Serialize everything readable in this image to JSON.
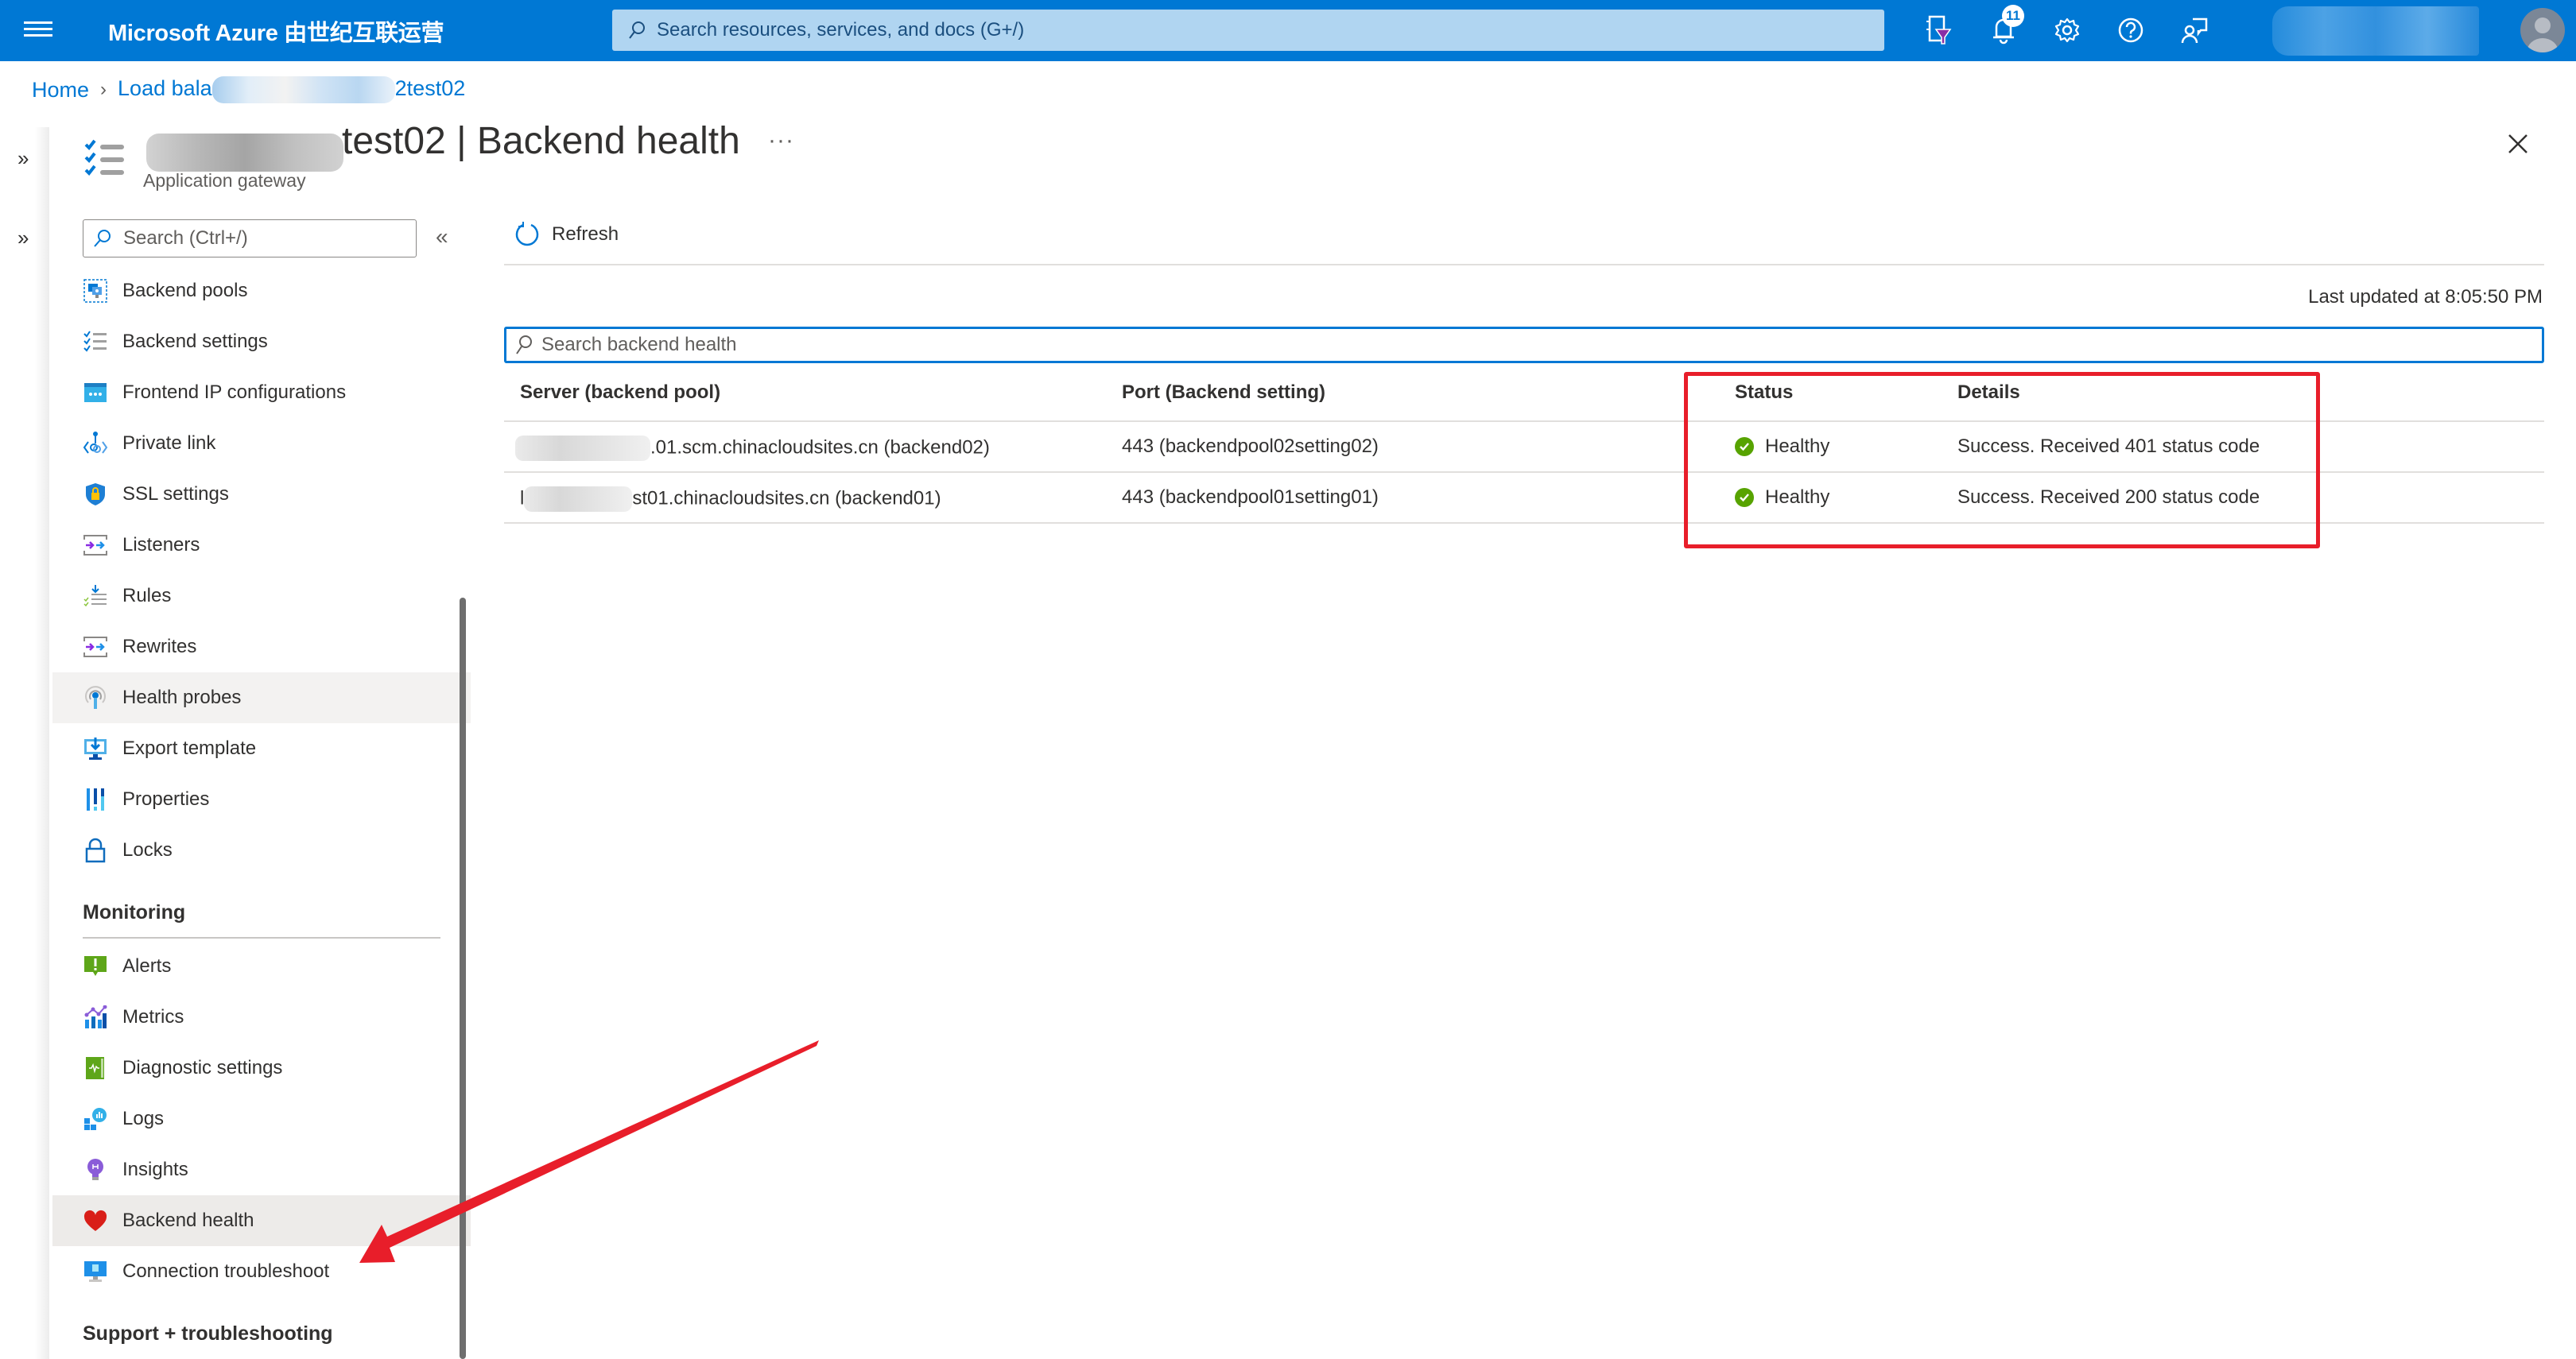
{
  "topbar": {
    "brand": "Microsoft Azure 由世纪互联运营",
    "search_placeholder": "Search resources, services, and docs (G+/)",
    "notification_count": "11",
    "icons": [
      "cloud-shell-filter-icon",
      "bell-icon",
      "gear-icon",
      "help-icon",
      "feedback-icon"
    ]
  },
  "breadcrumb": {
    "home": "Home",
    "parent_prefix": "Load bala",
    "parent_suffix": "2test02"
  },
  "blade": {
    "title_suffix": "test02 | Backend health",
    "subtitle": "Application gateway",
    "more": "···"
  },
  "sidebar": {
    "search_placeholder": "Search (Ctrl+/)",
    "items": [
      {
        "label": "Backend pools",
        "icon": "backend-pools-icon"
      },
      {
        "label": "Backend settings",
        "icon": "backend-settings-icon"
      },
      {
        "label": "Frontend IP configurations",
        "icon": "frontend-ip-icon"
      },
      {
        "label": "Private link",
        "icon": "private-link-icon"
      },
      {
        "label": "SSL settings",
        "icon": "ssl-shield-icon"
      },
      {
        "label": "Listeners",
        "icon": "listeners-icon"
      },
      {
        "label": "Rules",
        "icon": "rules-icon"
      },
      {
        "label": "Rewrites",
        "icon": "rewrites-icon"
      },
      {
        "label": "Health probes",
        "icon": "health-probes-icon"
      },
      {
        "label": "Export template",
        "icon": "export-template-icon"
      },
      {
        "label": "Properties",
        "icon": "properties-icon"
      },
      {
        "label": "Locks",
        "icon": "lock-icon"
      }
    ],
    "monitoring_heading": "Monitoring",
    "monitoring_items": [
      {
        "label": "Alerts",
        "icon": "alerts-icon"
      },
      {
        "label": "Metrics",
        "icon": "metrics-icon"
      },
      {
        "label": "Diagnostic settings",
        "icon": "diagnostic-settings-icon"
      },
      {
        "label": "Logs",
        "icon": "logs-icon"
      },
      {
        "label": "Insights",
        "icon": "insights-bulb-icon"
      },
      {
        "label": "Backend health",
        "icon": "heart-icon"
      },
      {
        "label": "Connection troubleshoot",
        "icon": "connection-troubleshoot-icon"
      }
    ],
    "support_heading": "Support + troubleshooting"
  },
  "main": {
    "refresh_label": "Refresh",
    "last_updated": "Last updated at 8:05:50 PM",
    "search_placeholder": "Search backend health",
    "columns": [
      "Server (backend pool)",
      "Port (Backend setting)",
      "Status",
      "Details"
    ],
    "rows": [
      {
        "server": ".01.scm.chinacloudsites.cn (backend02)",
        "server_prefix": "",
        "port": "443 (backendpool02setting02)",
        "status": "Healthy",
        "details": "Success. Received 401 status code"
      },
      {
        "server": "st01.chinacloudsites.cn (backend01)",
        "server_prefix": "l",
        "port": "443 (backendpool01setting01)",
        "status": "Healthy",
        "details": "Success. Received 200 status code"
      }
    ]
  },
  "colors": {
    "azure_blue": "#0078d4",
    "healthy_green": "#57a300",
    "annotation_red": "#e81e2a"
  }
}
